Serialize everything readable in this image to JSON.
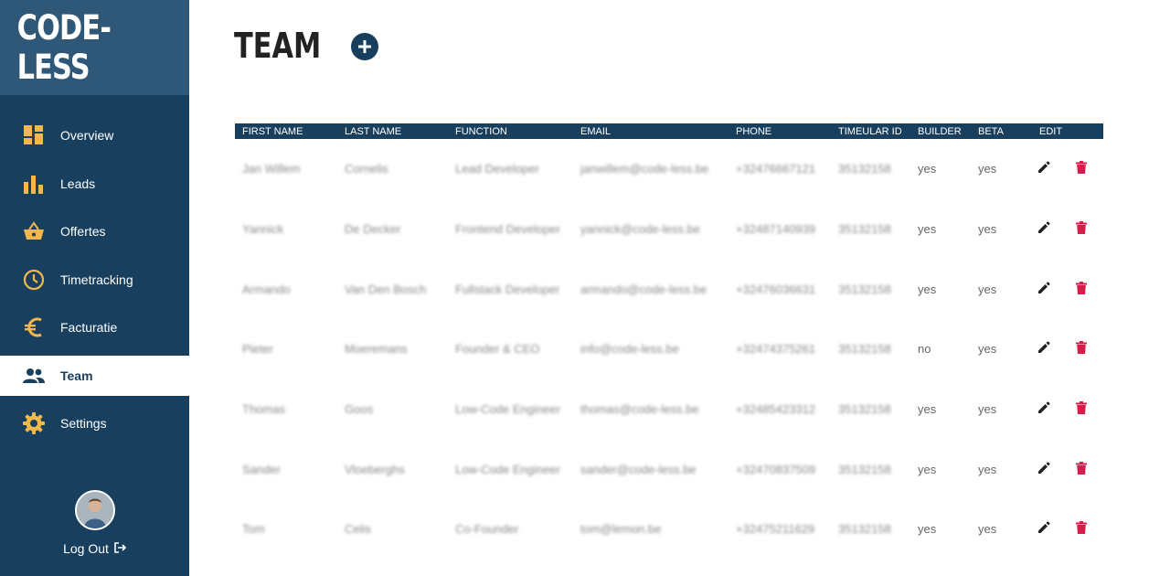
{
  "app": {
    "logo": "CODE-LESS"
  },
  "sidebar": {
    "items": [
      {
        "label": "Overview",
        "icon": "dashboard-icon",
        "active": false
      },
      {
        "label": "Leads",
        "icon": "bar-chart-icon",
        "active": false
      },
      {
        "label": "Offertes",
        "icon": "basket-icon",
        "active": false
      },
      {
        "label": "Timetracking",
        "icon": "clock-icon",
        "active": false
      },
      {
        "label": "Facturatie",
        "icon": "euro-icon",
        "active": false
      },
      {
        "label": "Team",
        "icon": "people-icon",
        "active": true
      },
      {
        "label": "Settings",
        "icon": "gear-icon",
        "active": false
      }
    ],
    "user": {
      "logout_label": "Log Out"
    }
  },
  "page": {
    "title": "TEAM"
  },
  "table": {
    "headers": [
      "FIRST NAME",
      "LAST NAME",
      "FUNCTION",
      "EMAIL",
      "PHONE",
      "TIMEULAR ID",
      "BUILDER",
      "BETA",
      "EDIT"
    ],
    "rows": [
      {
        "first": "Jan Willem",
        "last": "Cornelis",
        "function": "Lead Developer",
        "email": "janwillem@code-less.be",
        "phone": "+32476667121",
        "timeular": "35132158",
        "builder": "yes",
        "beta": "yes"
      },
      {
        "first": "Yannick",
        "last": "De Decker",
        "function": "Frontend Developer",
        "email": "yannick@code-less.be",
        "phone": "+32487140939",
        "timeular": "35132158",
        "builder": "yes",
        "beta": "yes"
      },
      {
        "first": "Armando",
        "last": "Van Den Bosch",
        "function": "Fullstack Developer",
        "email": "armando@code-less.be",
        "phone": "+32476036631",
        "timeular": "35132158",
        "builder": "yes",
        "beta": "yes"
      },
      {
        "first": "Pieter",
        "last": "Moeremans",
        "function": "Founder & CEO",
        "email": "info@code-less.be",
        "phone": "+32474375261",
        "timeular": "35132158",
        "builder": "no",
        "beta": "yes"
      },
      {
        "first": "Thomas",
        "last": "Goos",
        "function": "Low-Code Engineer",
        "email": "thomas@code-less.be",
        "phone": "+32485423312",
        "timeular": "35132158",
        "builder": "yes",
        "beta": "yes"
      },
      {
        "first": "Sander",
        "last": "Vloeberghs",
        "function": "Low-Code Engineer",
        "email": "sander@code-less.be",
        "phone": "+32470837509",
        "timeular": "35132158",
        "builder": "yes",
        "beta": "yes"
      },
      {
        "first": "Tom",
        "last": "Celis",
        "function": "Co-Founder",
        "email": "tom@lemon.be",
        "phone": "+32475211629",
        "timeular": "35132158",
        "builder": "yes",
        "beta": "yes"
      }
    ]
  },
  "colors": {
    "sidebar": "#183f5e",
    "logo_bg": "#2f5777",
    "icon_accent": "#f2b84b",
    "delete": "#d81b4a",
    "header": "#183f5e"
  }
}
